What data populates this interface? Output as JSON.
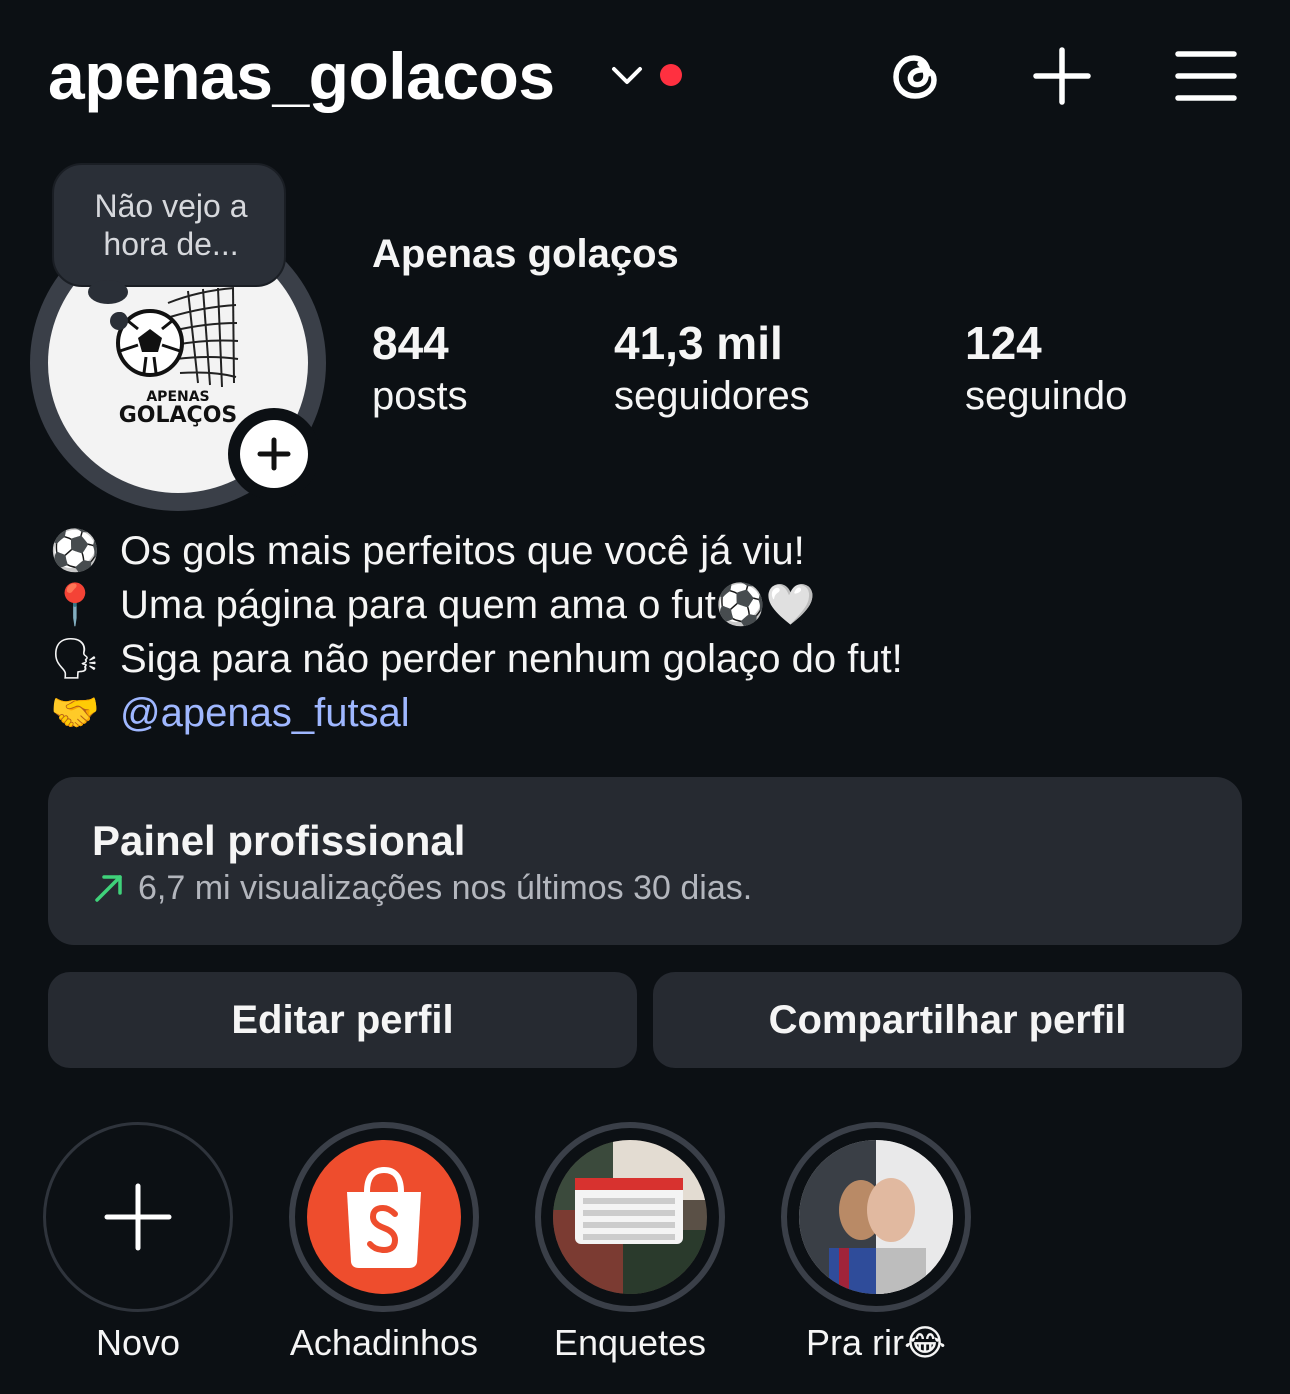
{
  "header": {
    "username": "apenas_golacos",
    "icons": [
      "chevron-down-icon",
      "notification-dot",
      "threads-icon",
      "plus-icon",
      "menu-icon"
    ]
  },
  "note": {
    "text_line1": "Não vejo a",
    "text_line2": "hora de..."
  },
  "avatar": {
    "logo_line1": "APENAS",
    "logo_line2": "GOLAÇOS"
  },
  "profile": {
    "full_name": "Apenas golaços",
    "stats": [
      {
        "value": "844",
        "label": "posts"
      },
      {
        "value": "41,3 mil",
        "label": "seguidores"
      },
      {
        "value": "124",
        "label": "seguindo"
      }
    ]
  },
  "bio": {
    "lines": [
      {
        "emoji": "⚽",
        "text": "Os gols mais perfeitos que você já viu!"
      },
      {
        "emoji": "📍",
        "text": "Uma página para quem ama o fut⚽🤍"
      },
      {
        "emoji": "🗣",
        "text": "Siga para não perder nenhum golaço do fut!"
      },
      {
        "emoji": "🤝",
        "text": "@apenas_futsal"
      }
    ]
  },
  "panel": {
    "title": "Painel profissional",
    "subtitle": "6,7 mi visualizações nos últimos 30 dias."
  },
  "buttons": {
    "edit": "Editar perfil",
    "share": "Compartilhar perfil"
  },
  "highlights": [
    {
      "label": "Novo"
    },
    {
      "label": "Achadinhos"
    },
    {
      "label": "Enquetes"
    },
    {
      "label": "Pra rir😂"
    }
  ],
  "colors": {
    "background": "#0c1014",
    "surface": "#262a31",
    "link": "#9fb7ff",
    "notification": "#ff3040",
    "trend_up": "#3fd27a",
    "shopee": "#ee4d2d"
  }
}
